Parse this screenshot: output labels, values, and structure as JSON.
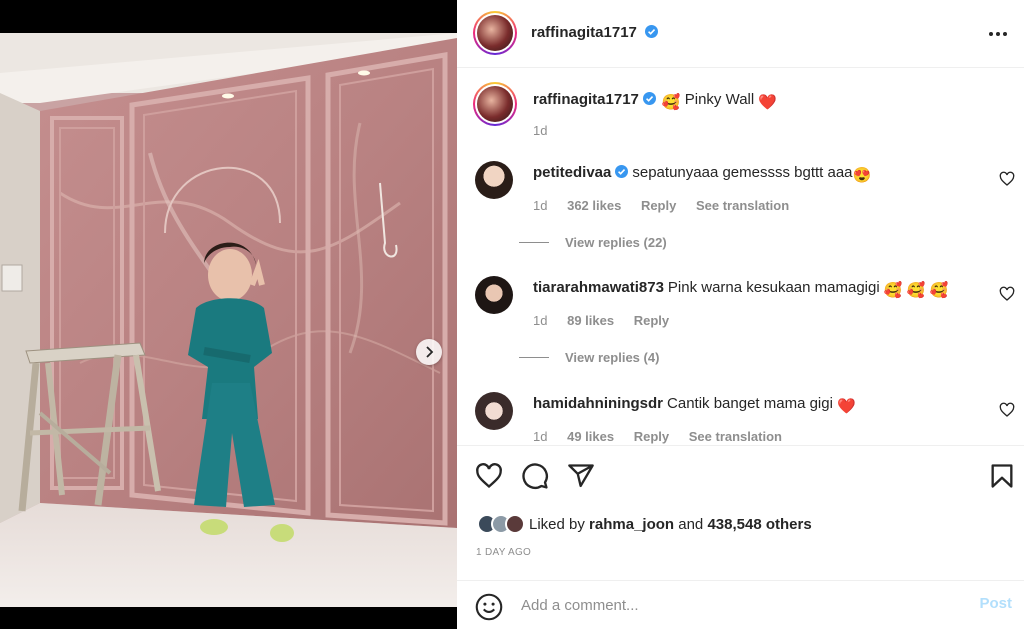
{
  "post": {
    "author": "raffinagita1717",
    "caption": "Pinky Wall",
    "caption_emoji_before": "🥰",
    "caption_emoji_after": "❤️",
    "age": "1d"
  },
  "comments": [
    {
      "user": "petitedivaa",
      "verified": true,
      "text": "sepatunyaaa gemessss bgttt aaa",
      "emoji": "😍",
      "age": "1d",
      "likes": "362 likes",
      "reply": "Reply",
      "translate": "See translation",
      "view_replies": "View replies (22)"
    },
    {
      "user": "tiararahmawati873",
      "verified": false,
      "text": "Pink warna kesukaan mamagigi",
      "emoji": "🥰 🥰 🥰",
      "age": "1d",
      "likes": "89 likes",
      "reply": "Reply",
      "view_replies": "View replies (4)"
    },
    {
      "user": "hamidahniningsdr",
      "verified": false,
      "text": "Cantik banget mama gigi",
      "emoji": "❤️",
      "age": "1d",
      "likes": "49 likes",
      "reply": "Reply",
      "translate": "See translation"
    }
  ],
  "likes": {
    "prefix": "Liked by",
    "user": "rahma_joon",
    "middle": "and",
    "count": "438,548 others"
  },
  "timestamp": "1 DAY AGO",
  "composer": {
    "placeholder": "Add a comment...",
    "post_label": "Post"
  },
  "colors": {
    "verified": "#3897f0",
    "heart": "#ed4956",
    "post_disabled": "#b2dffc",
    "wall": "#c9a3a3"
  },
  "icons": [
    "verified-icon",
    "more-icon",
    "heart-icon",
    "comment-icon",
    "share-icon",
    "bookmark-icon",
    "emoji-icon",
    "chevron-right-icon"
  ]
}
